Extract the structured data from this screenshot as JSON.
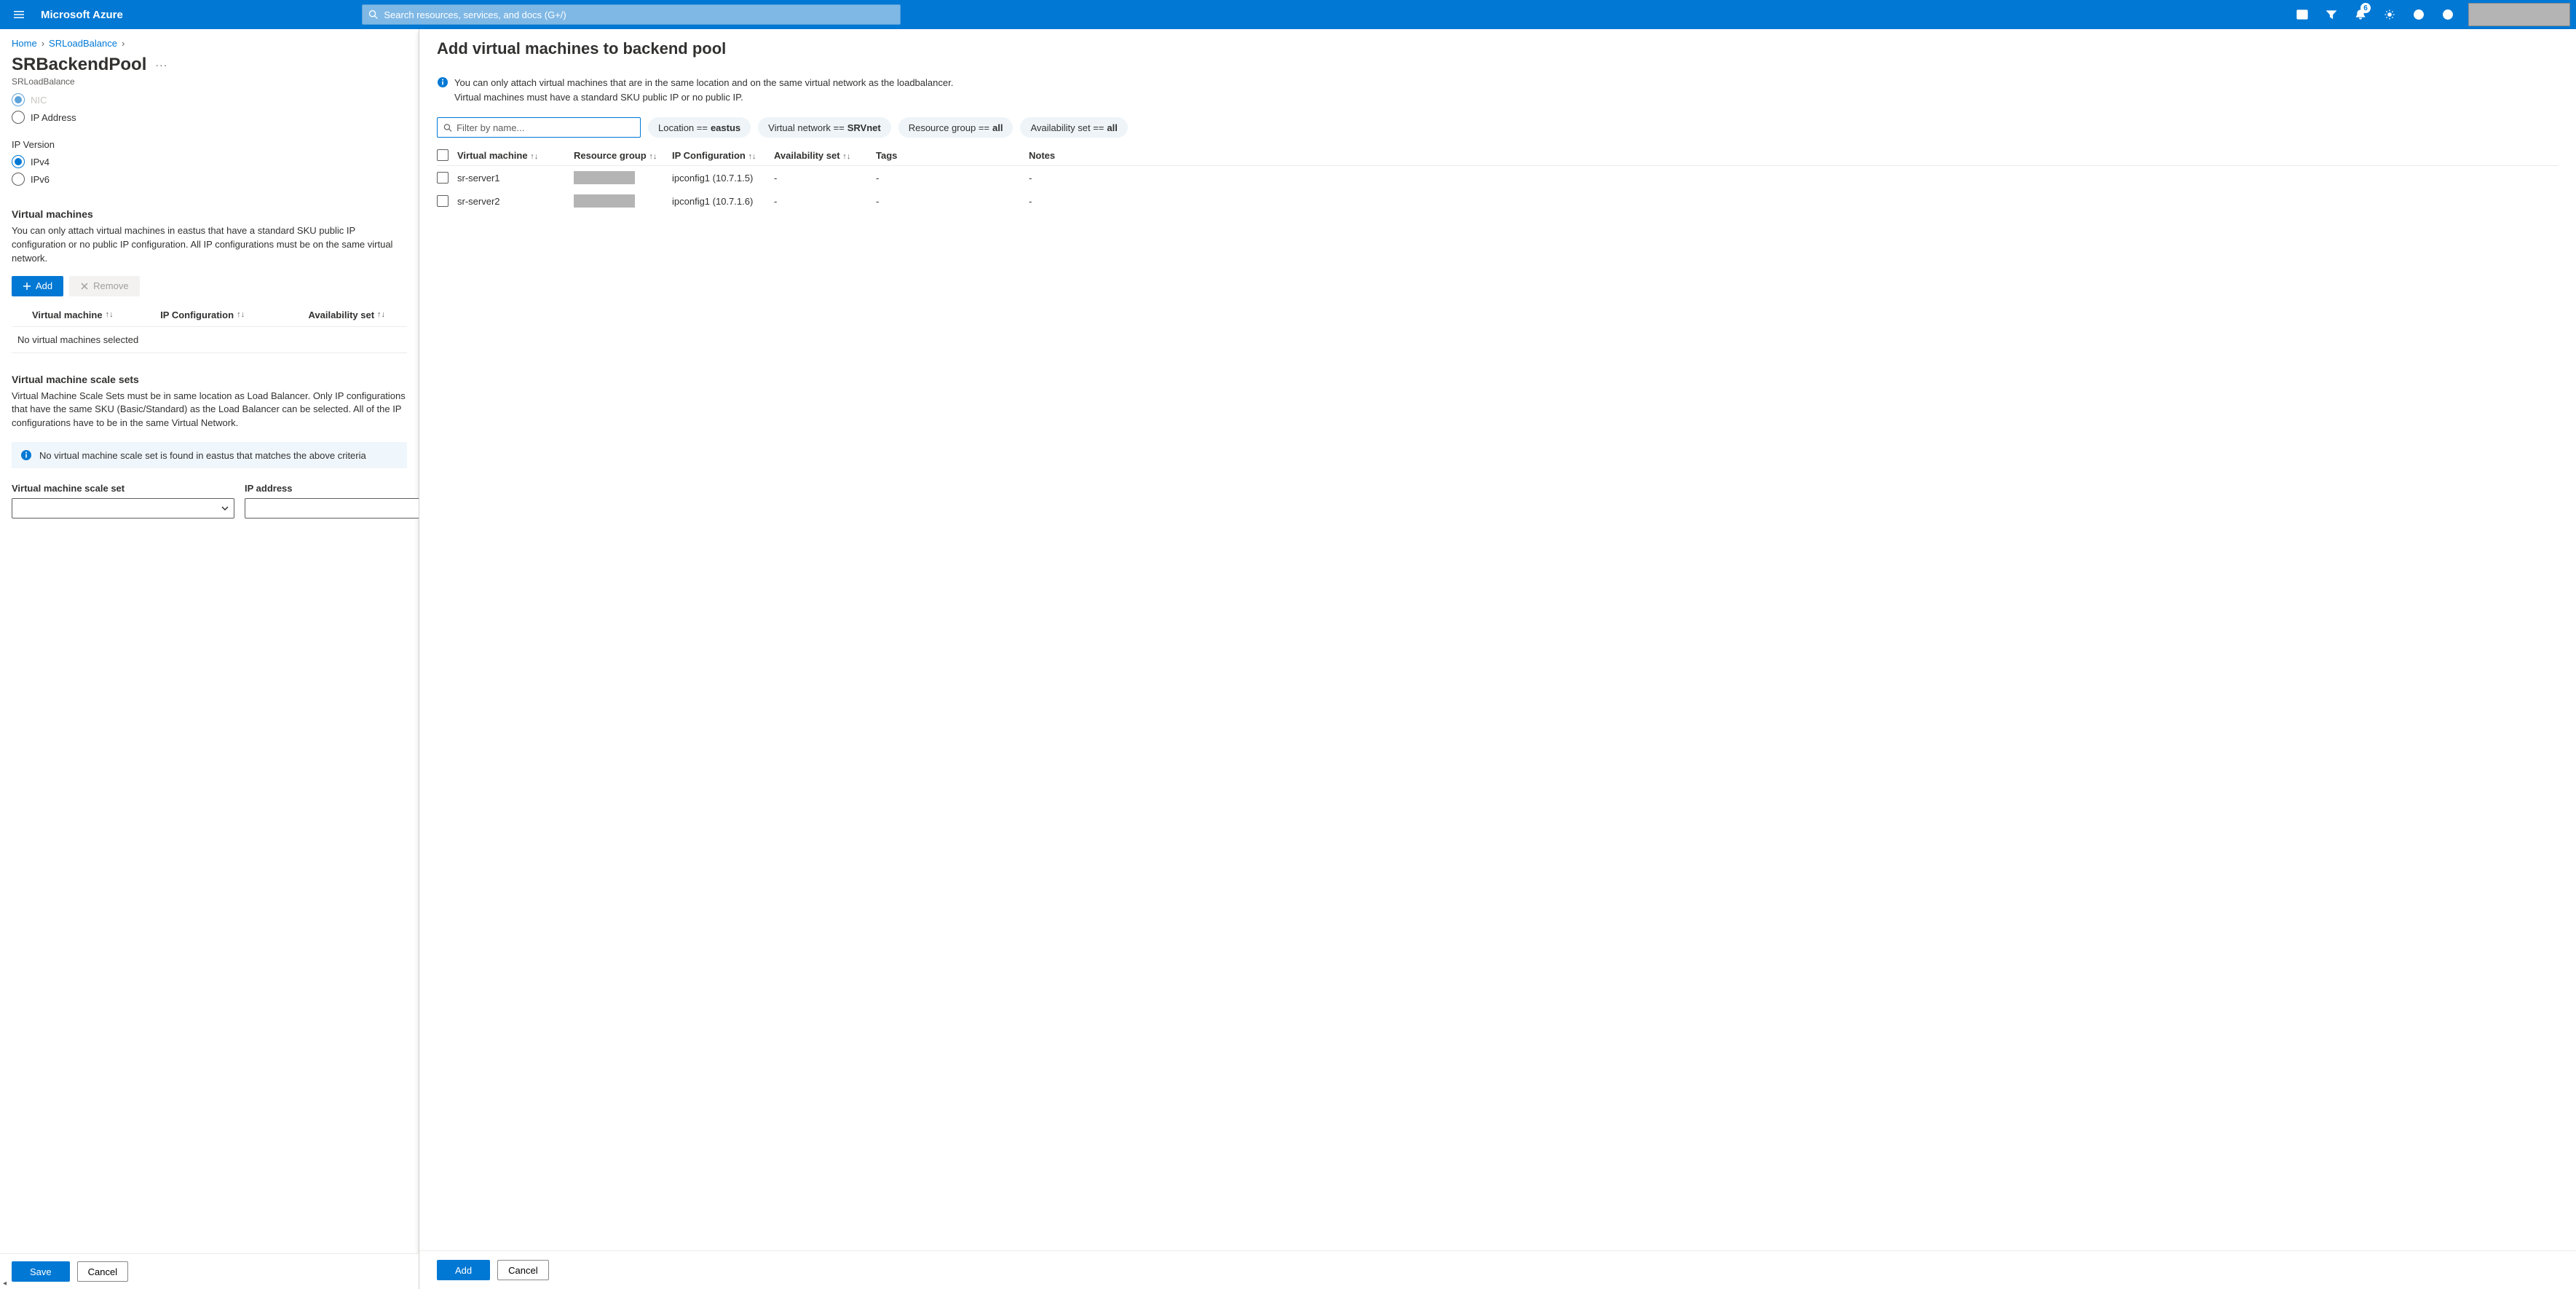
{
  "topbar": {
    "brand": "Microsoft Azure",
    "search_placeholder": "Search resources, services, and docs (G+/)",
    "notification_count": "6"
  },
  "breadcrumb": {
    "home": "Home",
    "item1": "SRLoadBalance"
  },
  "page": {
    "title": "SRBackendPool",
    "subtitle": "SRLoadBalance"
  },
  "left": {
    "radio_nic": "NIC",
    "radio_ip_address": "IP Address",
    "ip_version_label": "IP Version",
    "ipv4": "IPv4",
    "ipv6": "IPv6",
    "vm_heading": "Virtual machines",
    "vm_help": "You can only attach virtual machines in eastus that have a standard SKU public IP configuration or no public IP configuration. All IP configurations must be on the same virtual network.",
    "add_label": "Add",
    "remove_label": "Remove",
    "col_vm": "Virtual machine",
    "col_ipc": "IP Configuration",
    "col_as": "Availability set",
    "empty_vms": "No virtual machines selected",
    "vmss_heading": "Virtual machine scale sets",
    "vmss_help": "Virtual Machine Scale Sets must be in same location as Load Balancer. Only IP configurations that have the same SKU (Basic/Standard) as the Load Balancer can be selected. All of the IP configurations have to be in the same Virtual Network.",
    "vmss_info": "No virtual machine scale set is found in eastus that matches the above criteria",
    "vmss_col_label": "Virtual machine scale set",
    "vmss_ip_label": "IP address",
    "save": "Save",
    "cancel": "Cancel"
  },
  "right": {
    "title": "Add virtual machines to backend pool",
    "info_line1": "You can only attach virtual machines that are in the same location and on the same virtual network as the loadbalancer.",
    "info_line2": "Virtual machines must have a standard SKU public IP or no public IP.",
    "filter_placeholder": "Filter by name...",
    "pill_location_prefix": "Location == ",
    "pill_location_value": "eastus",
    "pill_vnet_prefix": "Virtual network == ",
    "pill_vnet_value": "SRVnet",
    "pill_rg_prefix": "Resource group == ",
    "pill_rg_value": "all",
    "pill_as_prefix": "Availability set == ",
    "pill_as_value": "all",
    "col_vm": "Virtual machine",
    "col_rg": "Resource group",
    "col_ipc": "IP Configuration",
    "col_as": "Availability set",
    "col_tags": "Tags",
    "col_notes": "Notes",
    "rows": [
      {
        "name": "sr-server1",
        "ipc": "ipconfig1 (10.7.1.5)",
        "as": "-",
        "tags": "-",
        "notes": "-"
      },
      {
        "name": "sr-server2",
        "ipc": "ipconfig1 (10.7.1.6)",
        "as": "-",
        "tags": "-",
        "notes": "-"
      }
    ],
    "add": "Add",
    "cancel": "Cancel"
  }
}
